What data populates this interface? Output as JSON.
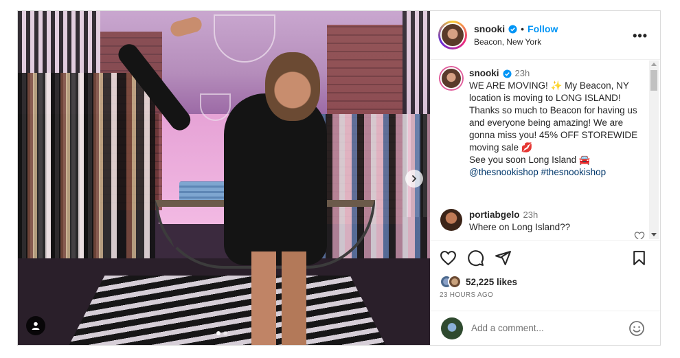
{
  "post": {
    "username": "snooki",
    "follow_label": "Follow",
    "separator": "•",
    "location": "Beacon, New York",
    "more_label": "•••"
  },
  "caption": {
    "username": "snooki",
    "time": "23h",
    "text": "WE ARE MOVING! ✨ My Beacon, NY location is moving to LONG ISLAND! Thanks so much to Beacon for having us and everyone being amazing! We are gonna miss you! 45% OFF STOREWIDE moving sale 💋\nSee you soon Long Island 🚘",
    "tags": [
      "@thesnookishop",
      "#thesnookishop"
    ]
  },
  "comments": [
    {
      "username": "portiabgelo",
      "time": "23h",
      "text": "Where on Long Island??"
    }
  ],
  "stats": {
    "likes": "52,225 likes",
    "time_ago": "23 HOURS AGO"
  },
  "add_comment": {
    "placeholder": "Add a comment..."
  },
  "carousel": {
    "total": 2,
    "current": 1
  },
  "colors": {
    "accent": "#0095f6",
    "hashtag": "#00376b",
    "text": "#262626",
    "muted": "#737373"
  },
  "icons": [
    "verified-icon",
    "more-icon",
    "next-icon",
    "user-tag-icon",
    "heart-icon",
    "comment-icon",
    "share-icon",
    "save-icon",
    "emoji-icon"
  ]
}
